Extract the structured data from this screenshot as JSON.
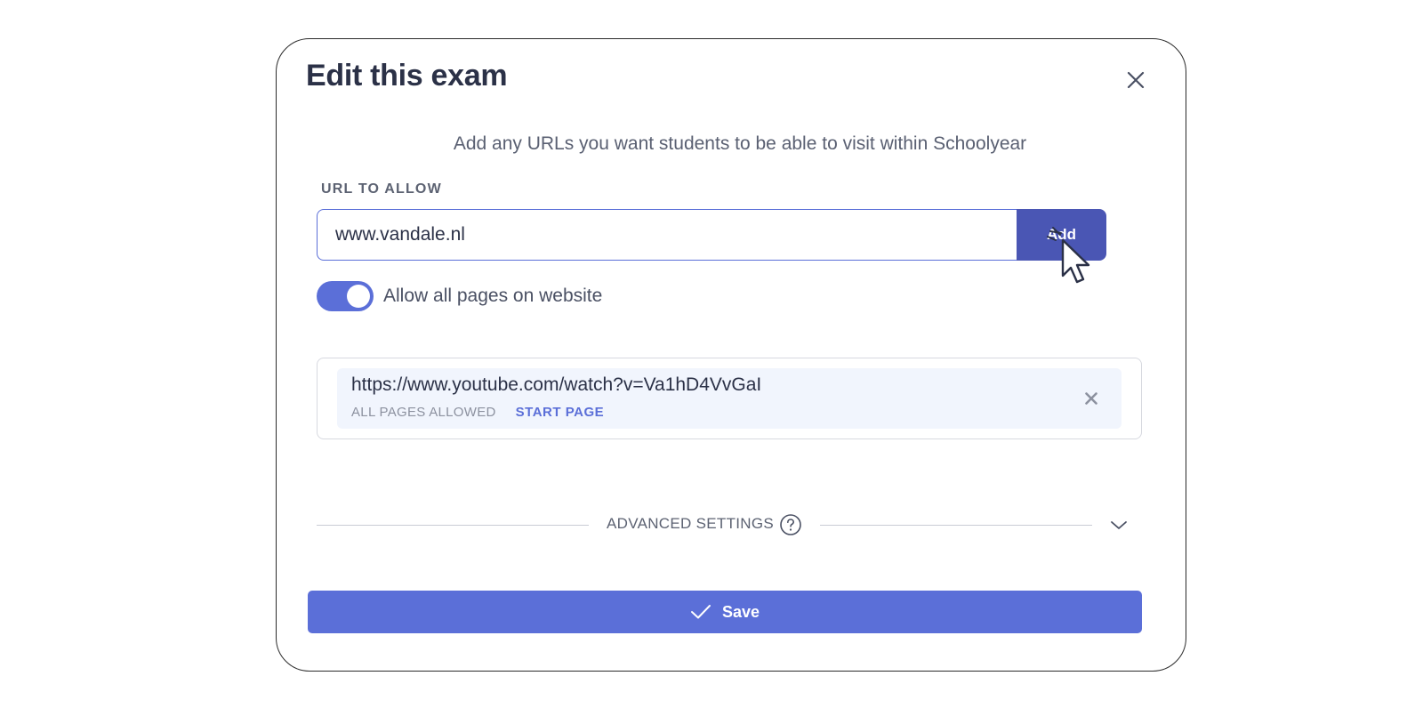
{
  "modal": {
    "title": "Edit this exam",
    "subtitle": "Add any URLs you want students to be able to visit within Schoolyear"
  },
  "url_input": {
    "label": "URL TO ALLOW",
    "value": "www.vandale.nl",
    "add_label": "Add"
  },
  "toggle": {
    "label": "Allow all pages on website",
    "checked": true
  },
  "allowed_urls": [
    {
      "url": "https://www.youtube.com/watch?v=Va1hD4VvGaI",
      "scope": "ALL PAGES ALLOWED",
      "action": "START PAGE"
    }
  ],
  "advanced": {
    "label": "ADVANCED SETTINGS"
  },
  "save": {
    "label": "Save"
  },
  "colors": {
    "accent": "#5b6fd8",
    "add_button": "#4a56b4",
    "text_dark": "#2b3147",
    "list_item_bg": "#f1f5fd"
  },
  "icons": {
    "close": "close-icon",
    "remove": "remove-icon",
    "help": "help-icon",
    "chevron": "chevron-down-icon",
    "check": "checkmark-icon",
    "cursor": "mouse-cursor-icon"
  }
}
